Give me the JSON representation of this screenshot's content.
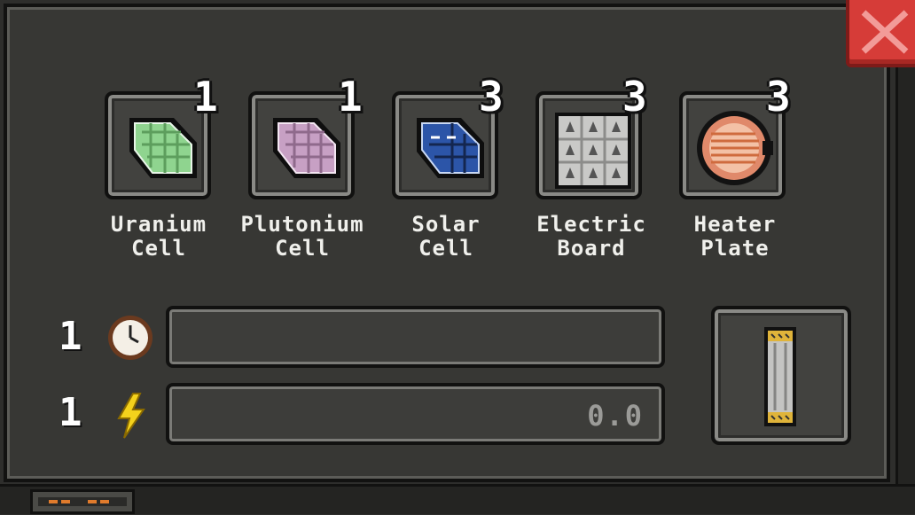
{
  "window": {
    "close_icon": "close-x-icon",
    "accent_color": "#d63c38"
  },
  "items": [
    {
      "name": "Uranium\nCell",
      "count": "1",
      "icon": "uranium-cell-icon",
      "color": "#8fd48f"
    },
    {
      "name": "Plutonium\nCell",
      "count": "1",
      "icon": "plutonium-cell-icon",
      "color": "#c7a0c4"
    },
    {
      "name": "Solar\nCell",
      "count": "3",
      "icon": "solar-cell-icon",
      "color": "#2c55a8"
    },
    {
      "name": "Electric\nBoard",
      "count": "3",
      "icon": "electric-board-icon",
      "color": "#c9c9c7"
    },
    {
      "name": "Heater\nPlate",
      "count": "3",
      "icon": "heater-plate-icon",
      "color": "#e0896a"
    }
  ],
  "rows": [
    {
      "count": "1",
      "icon": "clock-icon",
      "value": ""
    },
    {
      "count": "1",
      "icon": "lightning-icon",
      "value": "0.0"
    }
  ],
  "output": {
    "icon": "fuel-rod-icon"
  }
}
